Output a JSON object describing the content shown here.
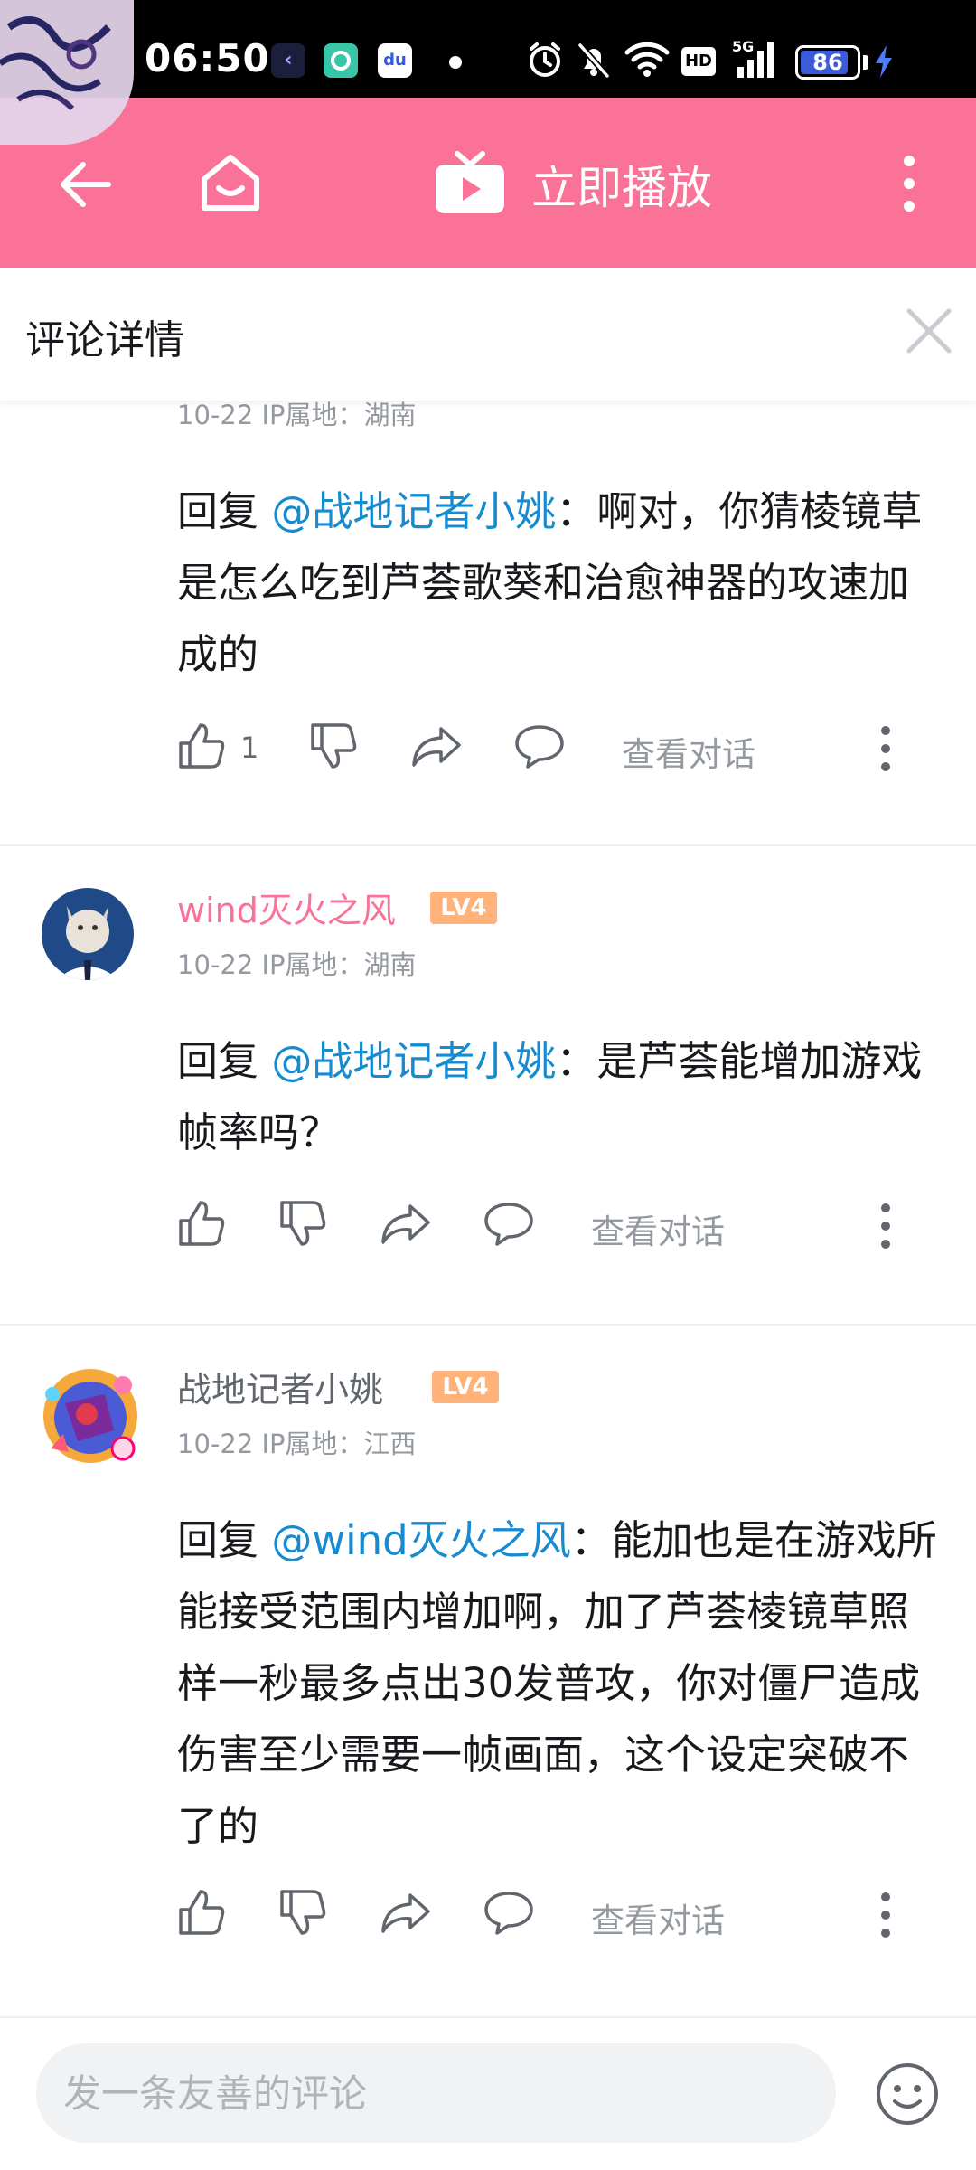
{
  "status_bar": {
    "time": "06:50",
    "battery": "86",
    "battery_level": 0.86,
    "signal_label": "5G",
    "hd_label": "HD",
    "icons": [
      "back-app-icon",
      "green-app-icon",
      "baidu-app-icon",
      "alarm-icon",
      "mute-icon",
      "wifi-icon",
      "hd-icon",
      "signal-icon",
      "battery-icon",
      "charging-icon"
    ]
  },
  "app_bar": {
    "title": "立即播放",
    "icons": [
      "back-arrow-icon",
      "home-icon",
      "tv-play-icon",
      "more-vertical-icon"
    ],
    "color": "#fb7299"
  },
  "panel": {
    "title": "评论详情",
    "close_icon": "close-icon"
  },
  "comments": [
    {
      "meta": "10-22  IP属地：湖南",
      "reply_prefix": "回复 ",
      "mention": "@战地记者小姚",
      "text": "：啊对，你猜棱镜草是怎么吃到芦荟歌葵和治愈神器的攻速加成的",
      "likes": "1",
      "view_dialog": "查看对话"
    },
    {
      "username": "wind灭火之风",
      "username_color": "#fb7299",
      "level": "LV4",
      "meta": "10-22  IP属地：湖南",
      "reply_prefix": "回复 ",
      "mention": "@战地记者小姚",
      "text": "：是芦荟能增加游戏帧率吗？",
      "view_dialog": "查看对话"
    },
    {
      "username": "战地记者小姚",
      "username_color": "#61666d",
      "level": "LV4",
      "meta": "10-22  IP属地：江西",
      "reply_prefix": "回复 ",
      "mention": "@wind灭火之风",
      "text": "：能加也是在游戏所能接受范围内增加啊，加了芦荟棱镜草照样一秒最多点出30发普攻，你对僵尸造成伤害至少需要一帧画面，这个设定突破不了的",
      "view_dialog": "查看对话"
    }
  ],
  "input": {
    "placeholder": "发一条友善的评论",
    "emoji_icon": "emoji-icon"
  },
  "colors": {
    "accent": "#fb7299",
    "mention": "#178bcf",
    "level_badge": "#ffb27a"
  }
}
